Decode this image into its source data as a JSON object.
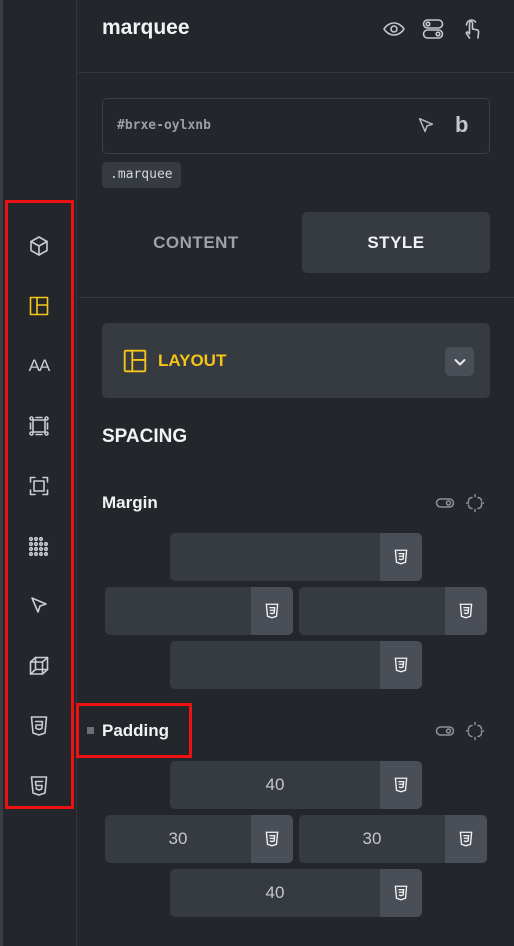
{
  "header": {
    "title": "marquee",
    "icons": [
      "eye-icon",
      "toggle-stack-icon",
      "touch-pointer-icon"
    ]
  },
  "element": {
    "id": "#brxe-oylxnb",
    "class_chip": ".marquee"
  },
  "tabs": [
    {
      "label": "CONTENT",
      "active": false
    },
    {
      "label": "STYLE",
      "active": true
    }
  ],
  "layout_group": {
    "label": "LAYOUT",
    "accent": "#f5c518"
  },
  "spacing": {
    "title": "SPACING",
    "margin": {
      "label": "Margin",
      "top": "",
      "left": "",
      "right": "",
      "bottom": ""
    },
    "padding": {
      "label": "Padding",
      "top": "40",
      "left": "30",
      "right": "30",
      "bottom": "40"
    }
  },
  "rail": {
    "items": [
      "cube-icon",
      "layout-grid-icon",
      "typography-icon",
      "border-frame-icon",
      "box-sizing-icon",
      "dots-grid-icon",
      "cursor-arrow-icon",
      "3d-box-icon",
      "css3-icon",
      "html5-icon"
    ],
    "active": "layout-grid-icon",
    "typography_text": "AA"
  },
  "colors": {
    "accent": "#f5c518",
    "highlight": "#ee1111",
    "panel": "#23262b"
  }
}
